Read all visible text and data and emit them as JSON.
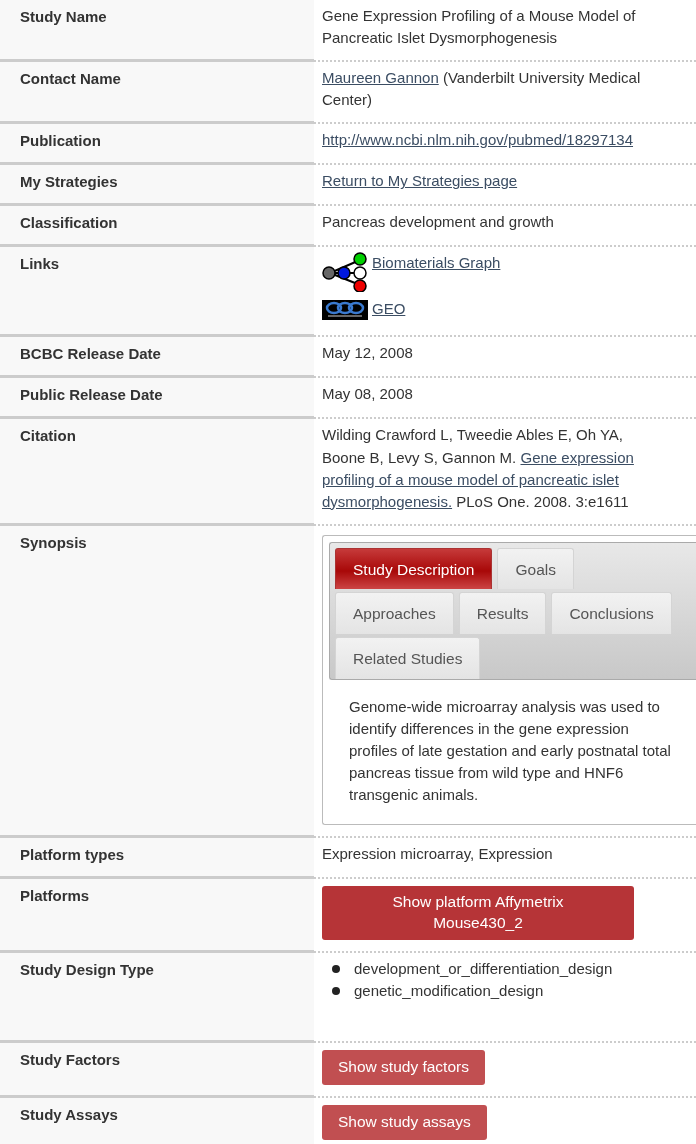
{
  "rows": [
    {
      "label": "Study Name",
      "value": {
        "kind": "text",
        "text": "Gene Expression Profiling of a Mouse Model of Pancreatic Islet Dysmorphogenesis"
      }
    },
    {
      "label": "Contact Name",
      "value": {
        "kind": "parts",
        "parts": [
          {
            "kind": "link",
            "text": "Maureen Gannon"
          },
          {
            "kind": "text",
            "text": " (Vanderbilt University Medical Center)"
          }
        ]
      }
    },
    {
      "label": "Publication",
      "value": {
        "kind": "parts",
        "parts": [
          {
            "kind": "link",
            "text": "http://www.ncbi.nlm.nih.gov/pubmed/18297134"
          }
        ]
      }
    },
    {
      "label": "My Strategies",
      "value": {
        "kind": "parts",
        "parts": [
          {
            "kind": "link",
            "text": "Return to My Strategies page"
          }
        ]
      }
    },
    {
      "label": "Classification",
      "value": {
        "kind": "text",
        "text": "Pancreas development and growth"
      }
    },
    {
      "label": "Links",
      "value": {
        "kind": "links",
        "items": [
          {
            "kind": "graph",
            "text": "Biomaterials Graph"
          },
          {
            "kind": "logo",
            "text": "GEO"
          }
        ]
      }
    },
    {
      "label": "BCBC Release Date",
      "value": {
        "kind": "text",
        "text": "May 12, 2008"
      }
    },
    {
      "label": "Public Release Date",
      "value": {
        "kind": "text",
        "text": "May 08, 2008"
      }
    },
    {
      "label": "Citation",
      "value": {
        "kind": "lines",
        "lines": [
          [
            {
              "kind": "text",
              "text": "Wilding Crawford L, Tweedie Ables E, Oh YA,"
            }
          ],
          [
            {
              "kind": "text",
              "text": "Boone B, Levy S, Gannon M."
            },
            {
              "kind": "link",
              "text": "Gene expression"
            }
          ],
          [
            {
              "kind": "link",
              "text": "profiling of a mouse model of pancreatic islet"
            }
          ],
          [
            {
              "kind": "link",
              "text": "dysmorphogenesis."
            },
            {
              "kind": "text",
              "text": "PLoS One. 2008. 3:e1611"
            }
          ]
        ]
      }
    },
    {
      "label": "Synopsis",
      "value": {
        "kind": "tabs",
        "tabs": [
          {
            "label": "Study Description",
            "selected": true
          },
          {
            "label": "Goals",
            "selected": false
          },
          {
            "label": "Approaches",
            "selected": false
          },
          {
            "label": "Results",
            "selected": false
          },
          {
            "label": "Conclusions",
            "selected": false
          },
          {
            "label": "Related Studies",
            "selected": false
          }
        ],
        "content": "Genome-wide microarray analysis was used to identify differences in the gene expression profiles of late gestation and early postnatal total pancreas tissue from wild type and HNF6 transgenic animals."
      }
    },
    {
      "label": "Platform types",
      "value": {
        "kind": "text",
        "text": "Expression microarray, Expression"
      }
    },
    {
      "label": "Platforms",
      "value": {
        "kind": "wide-button",
        "text": "Show platform Affymetrix Mouse430_2"
      }
    },
    {
      "label": "Study Design Type",
      "value": {
        "kind": "bullets",
        "items": [
          "development_or_differentiation_design",
          "genetic_modification_design"
        ]
      }
    },
    {
      "label": "Study Factors",
      "value": {
        "kind": "button",
        "text": "Show study factors"
      }
    },
    {
      "label": "Study Assays",
      "value": {
        "kind": "button",
        "text": "Show study assays"
      }
    }
  ]
}
